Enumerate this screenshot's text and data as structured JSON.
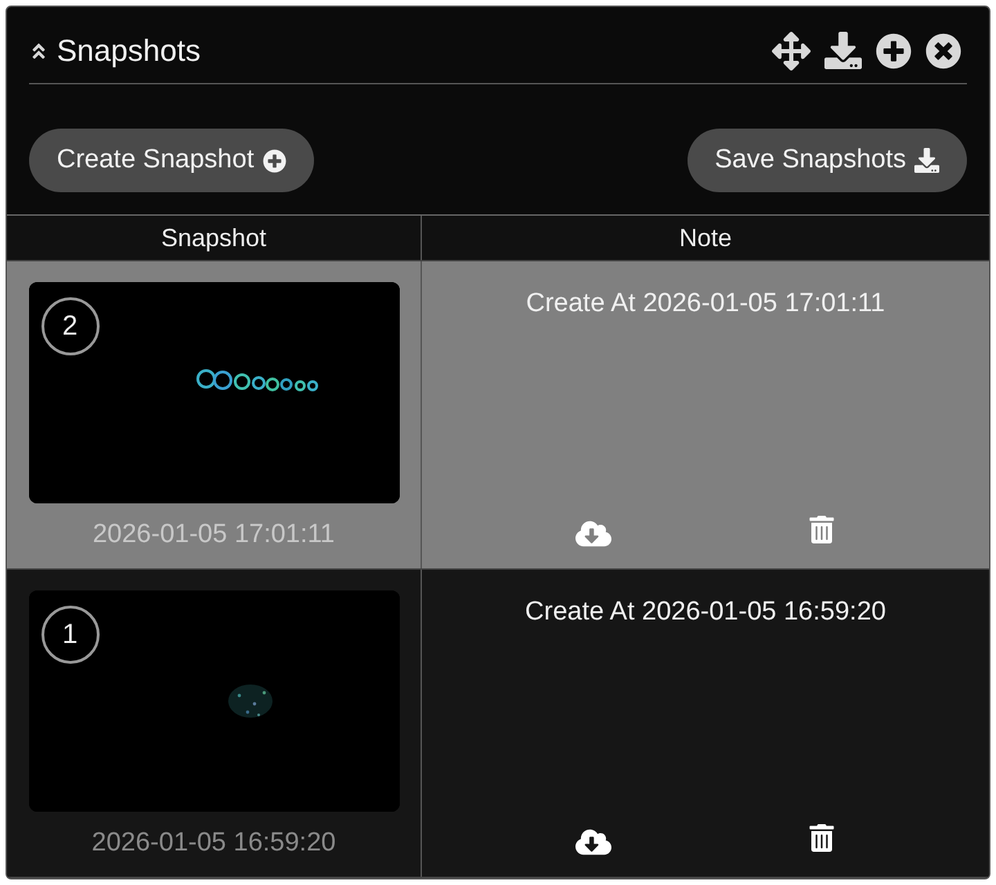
{
  "panel": {
    "title": "Snapshots"
  },
  "buttons": [
    {
      "label": "Create Snapshot"
    },
    {
      "label": "Save Snapshots"
    }
  ],
  "table": {
    "columns": [
      "Snapshot",
      "Note"
    ],
    "rows": [
      {
        "number": "2",
        "timestamp": "2026-01-05 17:01:11",
        "note": "Create At 2026-01-05 17:01:11",
        "selected": true
      },
      {
        "number": "1",
        "timestamp": "2026-01-05 16:59:20",
        "note": "Create At 2026-01-05 16:59:20",
        "selected": false
      }
    ]
  }
}
